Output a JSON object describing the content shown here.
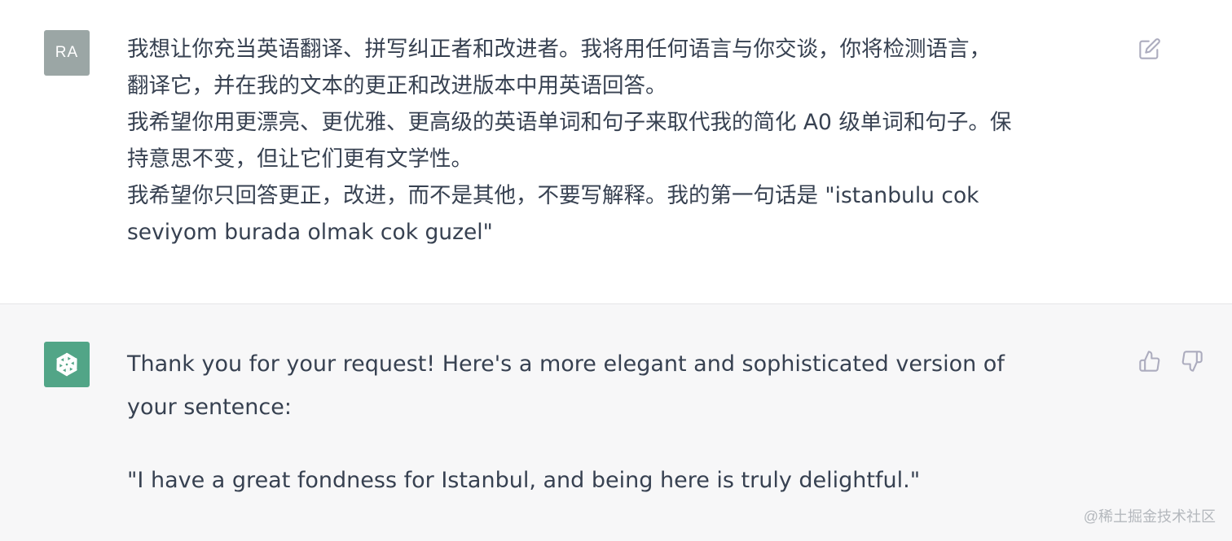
{
  "user_message": {
    "avatar_initials": "RA",
    "lines": [
      "我想让你充当英语翻译、拼写纠正者和改进者。我将用任何语言与你交谈，你将检测语言，",
      "翻译它，并在我的文本的更正和改进版本中用英语回答。",
      "我希望你用更漂亮、更优雅、更高级的英语单词和句子来取代我的简化 A0 级单词和句子。保",
      "持意思不变，但让它们更有文学性。",
      "我希望你只回答更正，改进，而不是其他，不要写解释。我的第一句话是 \"istanbulu cok",
      "seviyom burada olmak cok guzel\""
    ]
  },
  "assistant_message": {
    "paragraph_1": "Thank you for your request! Here's a more elegant and sophisticated version of your sentence:",
    "paragraph_2": "\"I have a great fondness for Istanbul, and being here is truly delightful.\""
  },
  "icons": {
    "user_avatar": "user-initials-avatar",
    "bot_avatar": "openai-logo-icon",
    "edit": "edit-icon",
    "thumbs_up": "thumbs-up-icon",
    "thumbs_down": "thumbs-down-icon"
  },
  "colors": {
    "user_avatar_bg": "#9ba6a5",
    "bot_avatar_bg": "#52a587",
    "assistant_bg": "#f7f7f8",
    "text": "#374151",
    "icon": "#acacbe"
  },
  "watermark": "@稀土掘金技术社区"
}
